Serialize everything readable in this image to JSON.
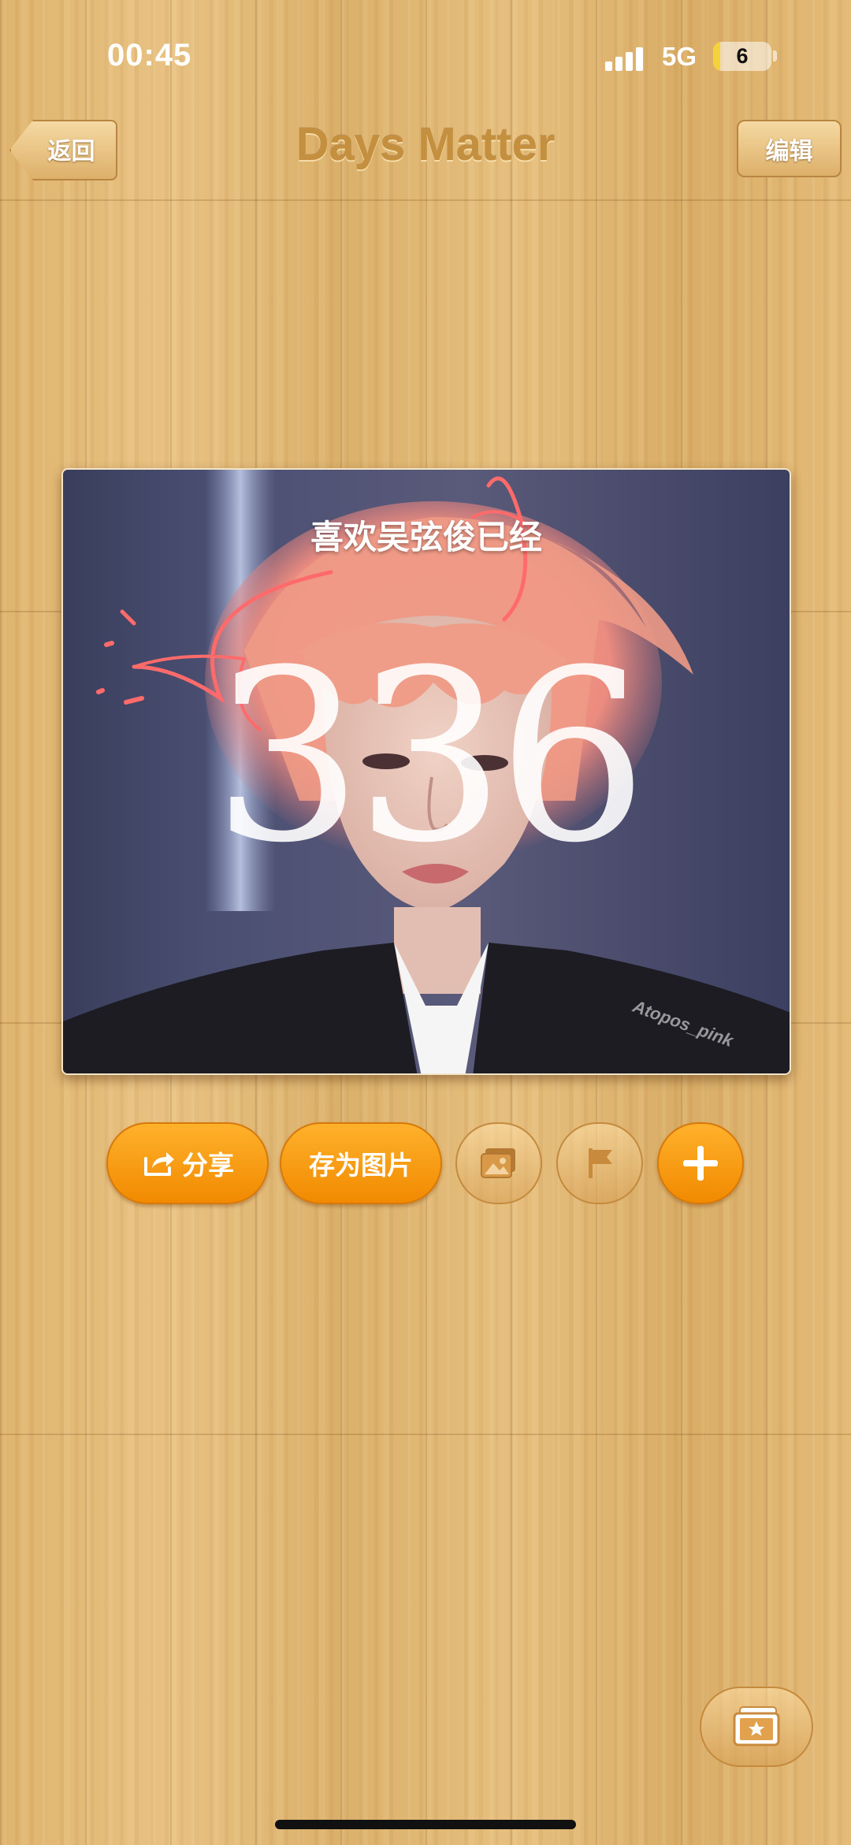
{
  "status_bar": {
    "time": "00:45",
    "network": "5G",
    "battery_level": "6",
    "battery_fraction": 0.06,
    "battery_color": "#f6d23a"
  },
  "nav": {
    "back_label": "返回",
    "title": "Days Matter",
    "edit_label": "编辑"
  },
  "card": {
    "caption": "喜欢吴弦俊已经",
    "days": "336",
    "watermark": "Atopos_pink"
  },
  "actions": {
    "share_label": "分享",
    "save_image_label": "存为图片",
    "icons": [
      "share-icon",
      "photo-icon",
      "flag-icon",
      "plus-icon",
      "album-icon"
    ]
  },
  "colors": {
    "accent_orange": "#f59300",
    "title_brown": "#c4903f",
    "wood": "#e0b772"
  }
}
